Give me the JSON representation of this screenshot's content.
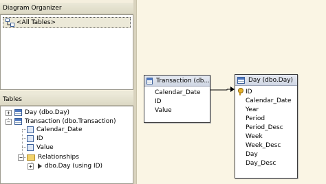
{
  "organizer": {
    "title": "Diagram Organizer",
    "item": "<All Tables>"
  },
  "tables_pane": {
    "title": "Tables",
    "tree": {
      "day": "Day (dbo.Day)",
      "transaction": "Transaction (dbo.Transaction)",
      "columns": [
        "Calendar_Date",
        "ID",
        "Value"
      ],
      "relationships": "Relationships",
      "relationship_item": "dbo.Day (using ID)"
    }
  },
  "diagram": {
    "transaction_table": {
      "title": "Transaction (db...",
      "columns": [
        "Calendar_Date",
        "ID",
        "Value"
      ]
    },
    "day_table": {
      "title": "Day (dbo.Day)",
      "columns": [
        "ID",
        "Calendar_Date",
        "Year",
        "Period",
        "Period_Desc",
        "Week",
        "Week_Desc",
        "Day",
        "Day_Desc"
      ]
    }
  }
}
